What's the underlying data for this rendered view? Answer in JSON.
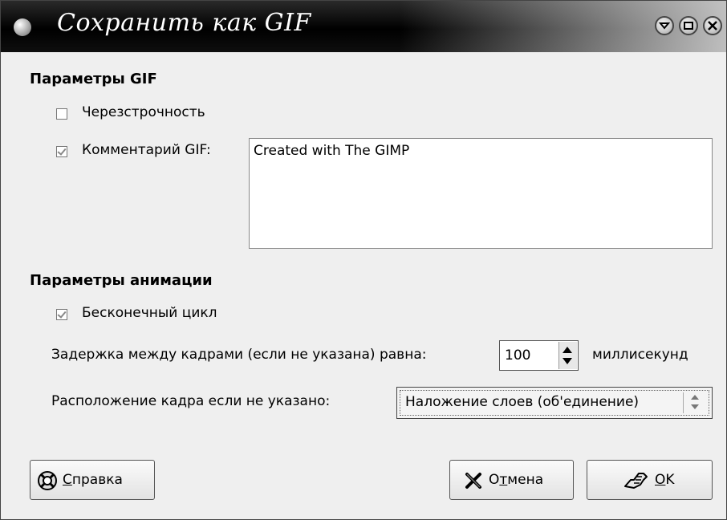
{
  "window": {
    "title": "Сохранить как GIF"
  },
  "gif_params": {
    "section_title": "Параметры GIF",
    "interlace_label": "Черезстрочность",
    "interlace_checked": false,
    "comment_label": "Комментарий GIF:",
    "comment_checked": true,
    "comment_value": "Created with The GIMP"
  },
  "anim_params": {
    "section_title": "Параметры анимации",
    "loop_label": "Бесконечный цикл",
    "loop_checked": true,
    "delay_label": "Задержка между кадрами (если не указана) равна:",
    "delay_value": "100",
    "delay_unit": "миллисекунд",
    "disposal_label": "Расположение кадра если не указано:",
    "disposal_value": "Наложение слоев (об'единение)"
  },
  "buttons": {
    "help_mnemonic": "С",
    "help_rest": "правка",
    "cancel_pre": "О",
    "cancel_mnemonic": "т",
    "cancel_rest": "мена",
    "ok_mnemonic": "O",
    "ok_rest": "K"
  },
  "icons": {
    "window_menu": "window-menu-icon",
    "minimize": "minimize-icon",
    "maximize": "maximize-icon",
    "close": "close-icon",
    "help": "lifebuoy-icon",
    "cancel": "cross-icon",
    "ok": "ok-hand-icon"
  }
}
